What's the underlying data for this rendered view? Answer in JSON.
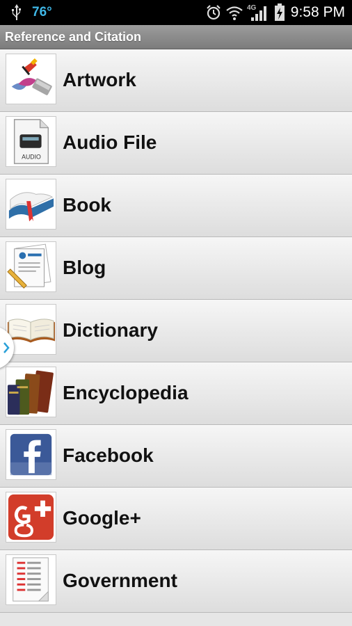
{
  "status_bar": {
    "temperature": "76°",
    "network": "4G LTE",
    "time": "9:58 PM",
    "accent_color": "#3fb7e6"
  },
  "title_bar": {
    "title": "Reference and Citation"
  },
  "items": [
    {
      "label": "Artwork",
      "icon": "artwork-icon"
    },
    {
      "label": "Audio File",
      "icon": "audio-file-icon",
      "icon_text": "AUDIO"
    },
    {
      "label": "Book",
      "icon": "book-icon"
    },
    {
      "label": "Blog",
      "icon": "blog-icon"
    },
    {
      "label": "Dictionary",
      "icon": "dictionary-icon"
    },
    {
      "label": "Encyclopedia",
      "icon": "encyclopedia-icon"
    },
    {
      "label": "Facebook",
      "icon": "facebook-icon"
    },
    {
      "label": "Google+",
      "icon": "google-plus-icon"
    },
    {
      "label": "Government",
      "icon": "government-icon"
    }
  ]
}
